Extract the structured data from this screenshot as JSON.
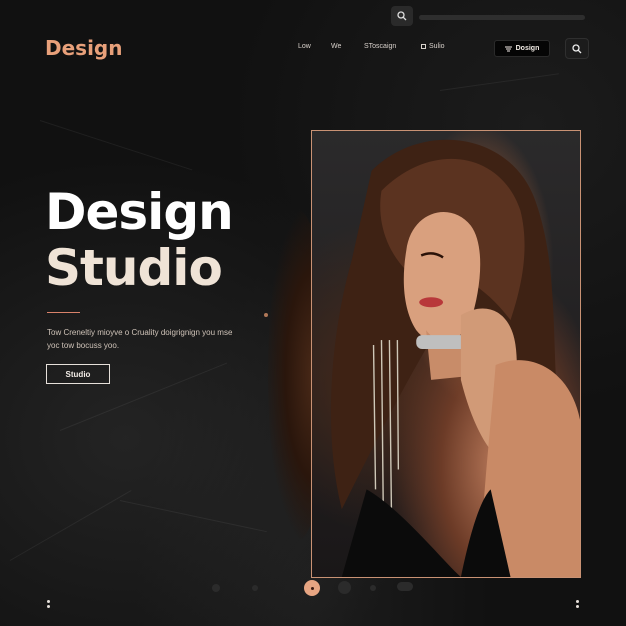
{
  "brand": {
    "logo_text": "Design"
  },
  "nav": {
    "items": [
      {
        "label": "Low"
      },
      {
        "label": "We"
      },
      {
        "label": "SToscaign"
      },
      {
        "label": "Sulio",
        "icon": "square-icon"
      }
    ],
    "cta_label": "Dosign",
    "cta_icon": "menu-lines-icon",
    "search_icon": "search-icon"
  },
  "hero": {
    "title_line1": "Design",
    "title_line2": "Studio",
    "description": "Tow Creneltiy mioyve o Cruality doigrignign you mse yoc tow bocuss yoo.",
    "button_label": "Studio"
  },
  "colors": {
    "accent": "#e8a07a",
    "background": "#111111",
    "frame_border": "#c99274"
  },
  "pager": {
    "active_index": 2,
    "count": 7
  }
}
